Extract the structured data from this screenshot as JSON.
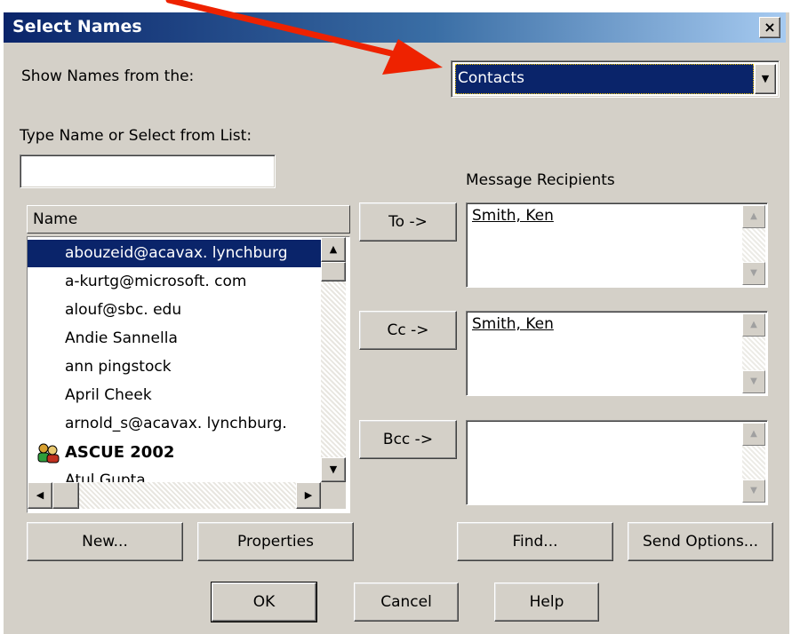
{
  "window": {
    "title": "Select Names",
    "close_glyph": "×"
  },
  "show_names": {
    "label": "Show Names from the:",
    "selected": "Contacts"
  },
  "type_name": {
    "label": "Type Name or Select from List:",
    "value": ""
  },
  "list": {
    "header": "Name",
    "items": [
      "abouzeid@acavax. lynchburg",
      "a-kurtg@microsoft. com",
      "alouf@sbc. edu",
      "Andie Sannella",
      "ann pingstock",
      "April Cheek",
      "arnold_s@acavax. lynchburg.",
      "ASCUE 2002",
      "Atul Gupta"
    ]
  },
  "recipients": {
    "label": "Message Recipients",
    "to_button": "To ->",
    "cc_button": "Cc ->",
    "bcc_button": "Bcc ->",
    "to": "Smith, Ken",
    "cc": "Smith, Ken",
    "bcc": ""
  },
  "buttons": {
    "new": "New...",
    "properties": "Properties",
    "find": "Find...",
    "send_options": "Send Options...",
    "ok": "OK",
    "cancel": "Cancel",
    "help": "Help"
  },
  "icons": {
    "dropdown": "▼",
    "up": "▲",
    "down": "▼",
    "left": "◀",
    "right": "▶",
    "group": "group-icon"
  },
  "colors": {
    "selection": "#0a246a",
    "annotation_arrow": "#ee2200",
    "dialog_bg": "#d4d0c8"
  }
}
